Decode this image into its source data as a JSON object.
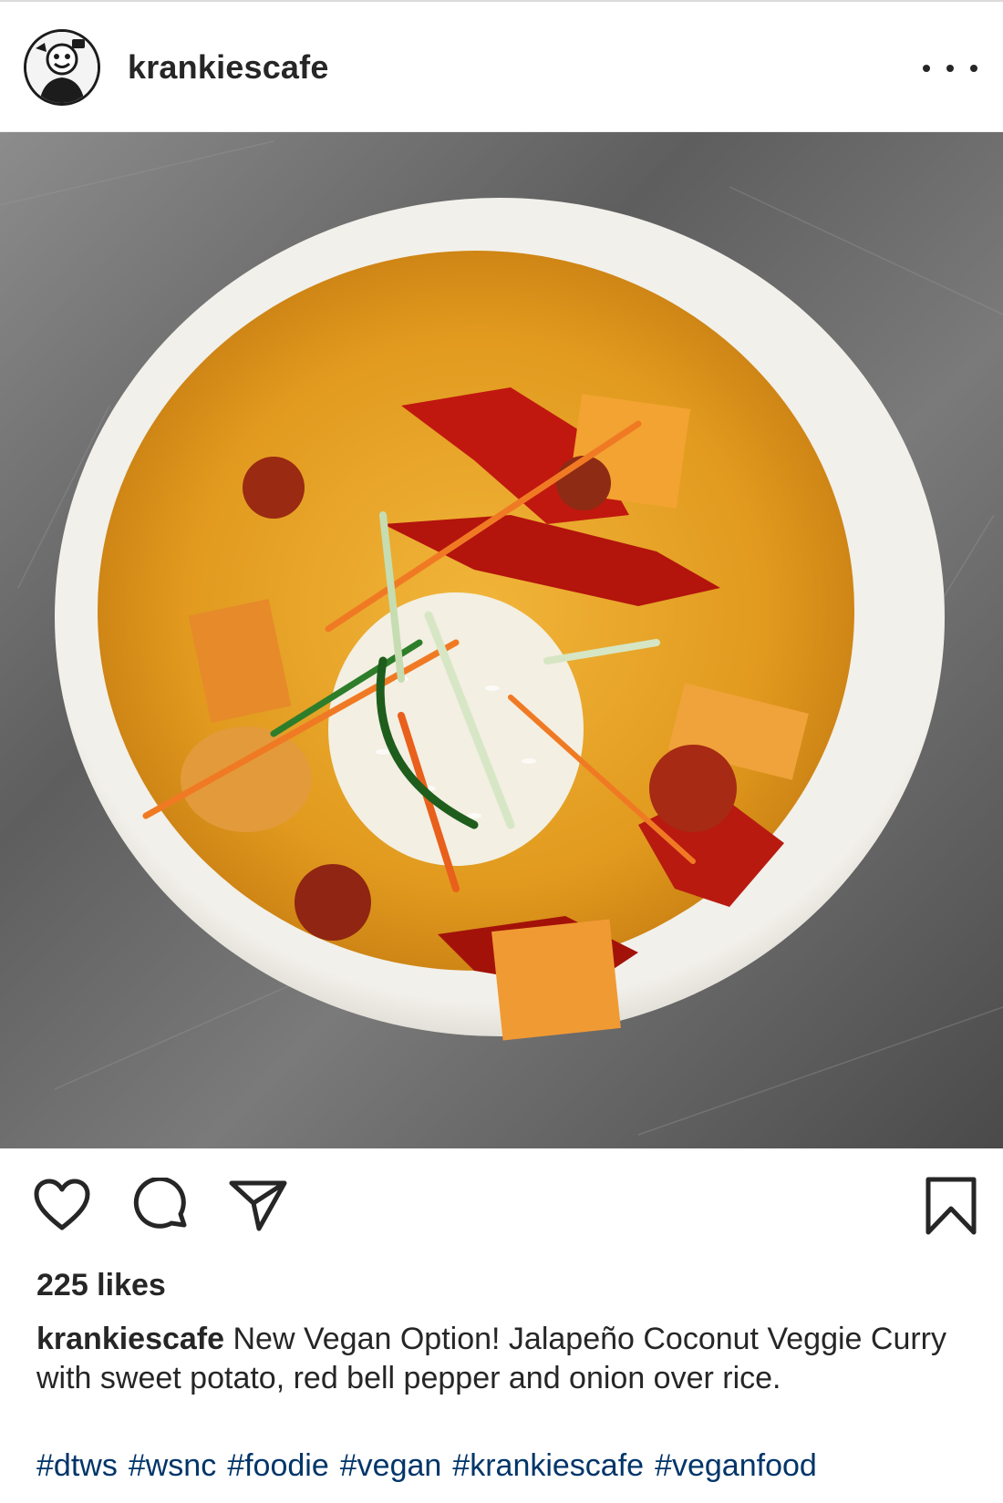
{
  "post": {
    "username": "krankiescafe",
    "likes": "225 likes",
    "caption": "New Vegan Option! Jalapeño Coconut Veggie Curry with sweet potato, red bell pepper and onion over rice.",
    "hashtags": [
      "#dtws",
      "#wsnc",
      "#foodie",
      "#vegan",
      "#krankiescafe",
      "#veganfood"
    ]
  },
  "icons": {
    "more": "more-options-icon",
    "like": "heart-icon",
    "comment": "comment-icon",
    "share": "paper-plane-icon",
    "save": "bookmark-icon"
  },
  "colors": {
    "text": "#262626",
    "hashtag": "#003569",
    "divider": "#efefef"
  }
}
